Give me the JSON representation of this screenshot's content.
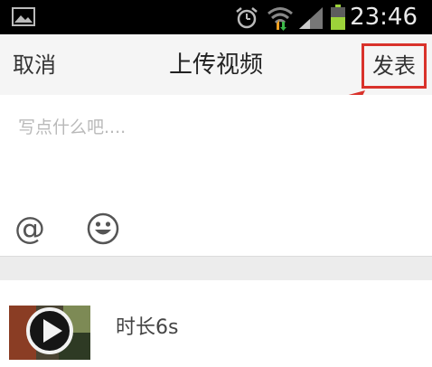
{
  "status_bar": {
    "time": "23:46",
    "icons": [
      "gallery-icon",
      "alarm-icon",
      "wifi-icon",
      "signal-icon",
      "battery-icon"
    ]
  },
  "nav": {
    "cancel_label": "取消",
    "title": "上传视频",
    "publish_label": "发表"
  },
  "compose": {
    "placeholder": "写点什么吧....",
    "tools": [
      "at-icon",
      "emoji-icon"
    ],
    "at_symbol": "@"
  },
  "video": {
    "duration_label": "时长6s"
  },
  "colors": {
    "highlight": "#d9322b",
    "status_bar": "#000000",
    "nav_bar": "#f5f5f5",
    "placeholder_text": "#b9b9b9",
    "band": "#ececec"
  }
}
